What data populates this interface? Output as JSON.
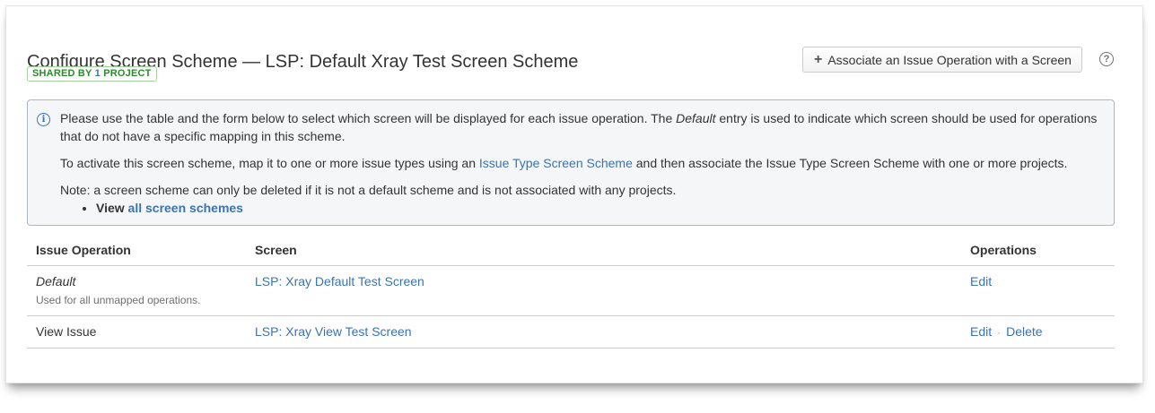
{
  "header": {
    "title": "Configure Screen Scheme — LSP: Default Xray Test Screen Scheme",
    "shared_prefix": "SHARED BY",
    "shared_count": "1",
    "shared_suffix": "PROJECT",
    "associate_button": "Associate an Issue Operation with a Screen",
    "help_symbol": "?"
  },
  "info": {
    "icon_symbol": "i",
    "p1_before": "Please use the table and the form below to select which screen will be displayed for each issue operation. The ",
    "p1_italic": "Default",
    "p1_after": " entry is used to indicate which screen should be used for operations that do not have a specific mapping in this scheme.",
    "p2_before": "To activate this screen scheme, map it to one or more issue types using an ",
    "p2_link": "Issue Type Screen Scheme",
    "p2_after": " and then associate the Issue Type Screen Scheme with one or more projects.",
    "p3": "Note: a screen scheme can only be deleted if it is not a default scheme and is not associated with any projects.",
    "list_prefix": "View",
    "list_link": "all screen schemes"
  },
  "table": {
    "headers": {
      "operation": "Issue Operation",
      "screen": "Screen",
      "operations": "Operations"
    },
    "rows": [
      {
        "operation": "Default",
        "description": "Used for all unmapped operations.",
        "screen": "LSP: Xray Default Test Screen",
        "edit": "Edit"
      },
      {
        "operation": "View Issue",
        "screen": "LSP: Xray View Test Screen",
        "edit": "Edit",
        "separator": "·",
        "delete": "Delete"
      }
    ]
  },
  "colors": {
    "link": "#3b73af",
    "badge_text": "#2b8a2b",
    "badge_border": "#a3d39c",
    "info_bg": "#f4f6f8",
    "info_border": "#aab8c6"
  },
  "icons": {
    "plus": "plus-icon",
    "help": "help-icon",
    "info": "info-icon"
  }
}
